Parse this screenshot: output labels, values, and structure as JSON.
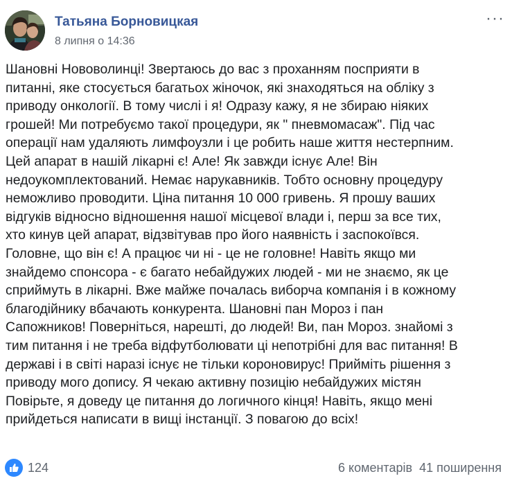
{
  "post": {
    "author": "Татьяна Борновицкая",
    "timestamp": "8 липня о 14:36",
    "more_icon": "more-dots-icon",
    "lines": [
      "Шановні Нововолинці! Звертаюсь до вас з проханням посприяти в",
      "питанні, яке стосується багатьох жіночок, які знаходяться на обліку з",
      "приводу онкології. В тому числі і я! Одразу кажу, я не збираю ніяких",
      "грошей! Ми потребуємо такої процедури, як \" пневмомасаж\". Під час",
      "операції нам удаляють лимфоузли і це робить наше життя нестерпним.",
      "Цей апарат в нашій лікарні є! Але! Як завжди існує Але! Він",
      "недоукомплектований. Немає нарукавників. Тобто основну процедуру",
      "неможливо проводити. Ціна питання 10 000 гривень. Я прошу ваших",
      "відгуків відносно відношення нашої місцевої влади і, перш за все тих,",
      "хто кинув цей апарат, відзвітував про його наявність і заспокоївся.",
      "Головне, що він є! А працює чи ні - це не головне! Навіть якщо ми",
      "знайдемо спонсора - є багато небайдужих людей - ми не знаємо, як це",
      "сприймуть в лікарні. Вже майже почалась виборча компанія і в кожному",
      "благодійнику вбачають конкурента. Шановні пан Мороз і пан",
      "Сапожников! Поверніться, нарешті, до людей! Ви, пан Мороз. знайомі з",
      "тим питання і не треба відфутболювати ці непотрібні для вас питання! В",
      "державі і в світі наразі існує не тільки короновирус! Прийміть рішення з",
      "приводу мого допису. Я чекаю активну позицію небайдужих містян",
      "Повірьте, я доведу це питання до логичного кінця! Навіть, якщо мені",
      "прийдеться написати в вищі інстанції. З повагою до всіх!"
    ]
  },
  "footer": {
    "like_icon": "thumbs-up-icon",
    "like_count": "124",
    "comments": "6 коментарів",
    "shares": "41 поширення"
  },
  "colors": {
    "author": "#385898",
    "meta": "#616770",
    "text": "#1c1e21",
    "like_badge": "#2d88ff"
  }
}
